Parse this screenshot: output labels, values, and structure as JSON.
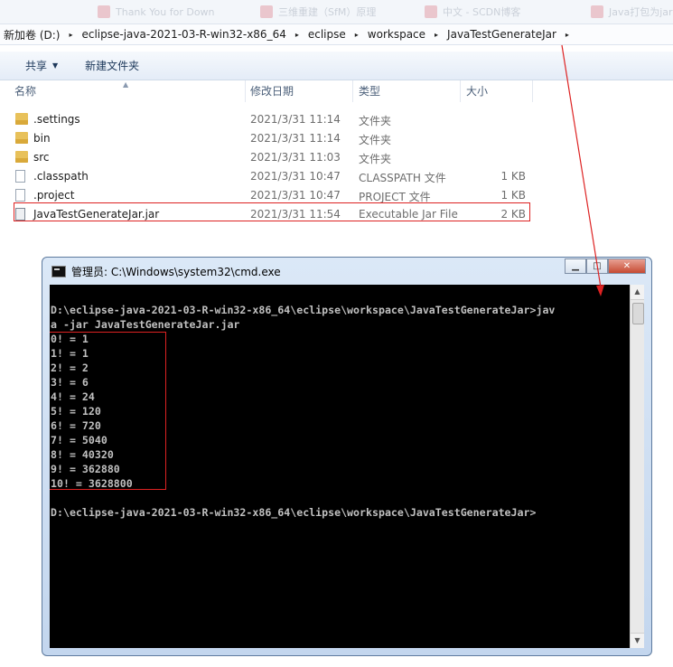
{
  "tabs": [
    {
      "label": "Thank You for Down"
    },
    {
      "label": "三维重建（SfM）原理"
    },
    {
      "label": "中文 - SCDN博客"
    },
    {
      "label": "Java打包为jar文件"
    }
  ],
  "breadcrumb": {
    "items": [
      "新加卷 (D:)",
      "eclipse-java-2021-03-R-win32-x86_64",
      "eclipse",
      "workspace",
      "JavaTestGenerateJar"
    ],
    "separator": "▸"
  },
  "toolbar": {
    "share_label": "共享",
    "new_folder_label": "新建文件夹"
  },
  "columns": {
    "name": "名称",
    "modified": "修改日期",
    "type": "类型",
    "size": "大小"
  },
  "files": [
    {
      "name": ".settings",
      "modified": "2021/3/31 11:14",
      "type": "文件夹",
      "size": "",
      "icon": "folder-icon"
    },
    {
      "name": "bin",
      "modified": "2021/3/31 11:14",
      "type": "文件夹",
      "size": "",
      "icon": "folder-icon"
    },
    {
      "name": "src",
      "modified": "2021/3/31 11:03",
      "type": "文件夹",
      "size": "",
      "icon": "folder-icon"
    },
    {
      "name": ".classpath",
      "modified": "2021/3/31 10:47",
      "type": "CLASSPATH 文件",
      "size": "1 KB",
      "icon": "file-icon"
    },
    {
      "name": ".project",
      "modified": "2021/3/31 10:47",
      "type": "PROJECT 文件",
      "size": "1 KB",
      "icon": "file-icon"
    },
    {
      "name": "JavaTestGenerateJar.jar",
      "modified": "2021/3/31 11:54",
      "type": "Executable Jar File",
      "size": "2 KB",
      "icon": "jar-file-icon"
    }
  ],
  "cmd": {
    "title": "管理员: C:\\Windows\\system32\\cmd.exe",
    "minimize_glyph": "▁",
    "maximize_glyph": "□",
    "close_glyph": "✕",
    "output": "D:\\eclipse-java-2021-03-R-win32-x86_64\\eclipse\\workspace\\JavaTestGenerateJar>jav\na -jar JavaTestGenerateJar.jar\n0! = 1\n1! = 1\n2! = 2\n3! = 6\n4! = 24\n5! = 120\n6! = 720\n7! = 5040\n8! = 40320\n9! = 362880\n10! = 3628800\n\nD:\\eclipse-java-2021-03-R-win32-x86_64\\eclipse\\workspace\\JavaTestGenerateJar>"
  },
  "colors": {
    "highlight": "#dd2222",
    "console_bg": "#000000",
    "console_fg": "#c0c0c0"
  }
}
